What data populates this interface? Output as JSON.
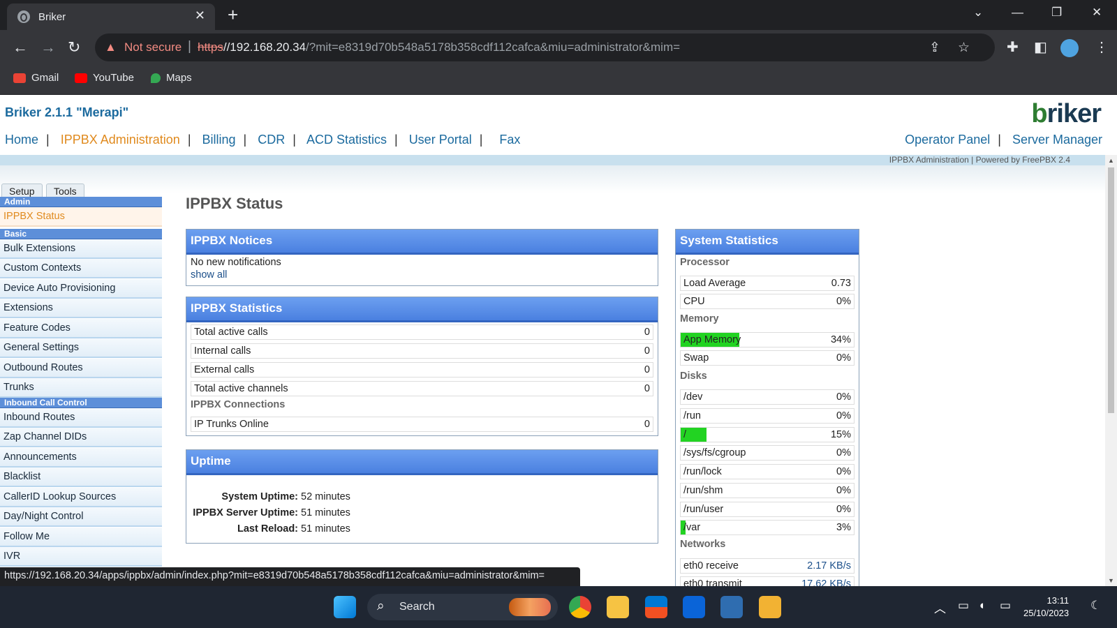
{
  "browser": {
    "tab_title": "Briker",
    "security_label": "Not secure",
    "url_scheme": "https",
    "url_host": "//192.168.20.34",
    "url_path": "/?mit=e8319d70b548a5178b358cdf112cafca&miu=administrator&mim=",
    "bookmarks": [
      {
        "label": "Gmail",
        "color": "#ea4335"
      },
      {
        "label": "YouTube",
        "color": "#ff0000"
      },
      {
        "label": "Maps",
        "color": "#34a853"
      }
    ],
    "status_url": "https://192.168.20.34/apps/ippbx/admin/index.php?mit=e8319d70b548a5178b358cdf112cafca&miu=administrator&mim="
  },
  "header": {
    "app_title": "Briker 2.1.1 \"Merapi\"",
    "logo_text": "briker",
    "nav": [
      "Home",
      "IPPBX Administration",
      "Billing",
      "CDR",
      "ACD Statistics",
      "User Portal",
      "Fax"
    ],
    "active_nav": "IPPBX Administration",
    "right_nav": [
      "Operator Panel",
      "Server Manager"
    ],
    "powered_by": "IPPBX Administration | Powered by FreePBX 2.4"
  },
  "sidebar": {
    "tabs": [
      "Setup",
      "Tools"
    ],
    "sections": {
      "admin": "Admin",
      "basic": "Basic",
      "inbound": "Inbound Call Control"
    },
    "admin_items": [
      "IPPBX Status"
    ],
    "basic_items": [
      "Bulk Extensions",
      "Custom Contexts",
      "Device Auto Provisioning",
      "Extensions",
      "Feature Codes",
      "General Settings",
      "Outbound Routes",
      "Trunks"
    ],
    "inbound_items": [
      "Inbound Routes",
      "Zap Channel DIDs",
      "Announcements",
      "Blacklist",
      "CallerID Lookup Sources",
      "Day/Night Control",
      "Follow Me",
      "IVR"
    ]
  },
  "main": {
    "heading": "IPPBX Status",
    "notices": {
      "title": "IPPBX Notices",
      "message": "No new notifications",
      "show_all": "show all"
    },
    "stats": {
      "title": "IPPBX Statistics",
      "rows": [
        {
          "label": "Total active calls",
          "value": "0"
        },
        {
          "label": "Internal calls",
          "value": "0"
        },
        {
          "label": "External calls",
          "value": "0"
        },
        {
          "label": "Total active channels",
          "value": "0"
        }
      ],
      "connections_heading": "IPPBX Connections",
      "connections": [
        {
          "label": "IP Trunks Online",
          "value": "0"
        }
      ]
    },
    "uptime": {
      "title": "Uptime",
      "rows": [
        {
          "label": "System Uptime:",
          "value": "52 minutes"
        },
        {
          "label": "IPPBX Server Uptime:",
          "value": "51 minutes"
        },
        {
          "label": "Last Reload:",
          "value": "51 minutes"
        }
      ]
    }
  },
  "system_stats": {
    "title": "System Statistics",
    "processor_heading": "Processor",
    "processor": [
      {
        "label": "Load Average",
        "value": "0.73"
      },
      {
        "label": "CPU",
        "value": "0%",
        "fill": 0
      }
    ],
    "memory_heading": "Memory",
    "memory": [
      {
        "label": "App Memory",
        "value": "34%",
        "fill": 0.34
      },
      {
        "label": "Swap",
        "value": "0%",
        "fill": 0
      }
    ],
    "disks_heading": "Disks",
    "disks": [
      {
        "label": "/dev",
        "value": "0%",
        "fill": 0
      },
      {
        "label": "/run",
        "value": "0%",
        "fill": 0
      },
      {
        "label": "/",
        "value": "15%",
        "fill": 0.15
      },
      {
        "label": "/sys/fs/cgroup",
        "value": "0%",
        "fill": 0
      },
      {
        "label": "/run/lock",
        "value": "0%",
        "fill": 0
      },
      {
        "label": "/run/shm",
        "value": "0%",
        "fill": 0
      },
      {
        "label": "/run/user",
        "value": "0%",
        "fill": 0
      },
      {
        "label": "/var",
        "value": "3%",
        "fill": 0.03
      }
    ],
    "networks_heading": "Networks",
    "networks": [
      {
        "label": "eth0 receive",
        "value": "2.17 KB/s"
      },
      {
        "label": "eth0 transmit",
        "value": "17.62 KB/s"
      }
    ]
  },
  "taskbar": {
    "search_label": "Search",
    "time": "13:11",
    "date": "25/10/2023"
  }
}
